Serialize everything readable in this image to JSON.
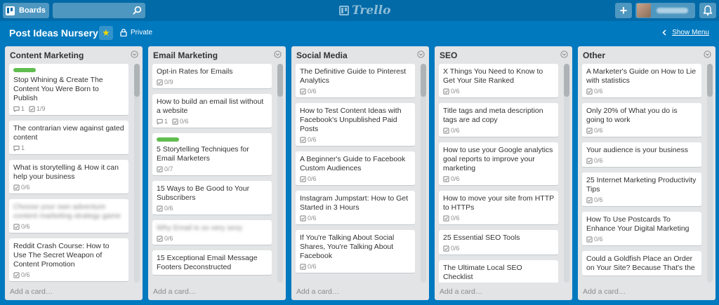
{
  "topbar": {
    "boards_label": "Boards",
    "search_placeholder": "",
    "logo_text": "Trello",
    "add_label": "+"
  },
  "board": {
    "title": "Post Ideas Nursery",
    "star": "★",
    "privacy": "Private",
    "show_menu": "Show Menu"
  },
  "add_card_label": "Add a card…",
  "lists": [
    {
      "title": "Content Marketing",
      "cards": [
        {
          "label": "green",
          "title": "Stop Whining & Create The Content You Were Born to Publish",
          "blurred": false,
          "comments": "1",
          "checklist": "1/9"
        },
        {
          "title": "The contrarian view against gated content",
          "blurred": false,
          "comments": "1"
        },
        {
          "title": "What is storytelling & How it can help your business",
          "blurred": false,
          "checklist": "0/6"
        },
        {
          "title": "Choose your own adventure content marketing strategy game",
          "blurred": true,
          "checklist": "0/6"
        },
        {
          "title": "Reddit Crash Course: How to Use The Secret Weapon of Content Promotion",
          "blurred": false,
          "checklist": "0/6"
        }
      ]
    },
    {
      "title": "Email Marketing",
      "cards": [
        {
          "title": "Opt-in Rates for Emails",
          "blurred": false,
          "checklist": "0/9"
        },
        {
          "title": "How to build an email list without a website",
          "blurred": false,
          "comments": "1",
          "checklist": "0/6"
        },
        {
          "label": "green",
          "title": "5 Storytelling Techniques for Email Marketers",
          "blurred": false,
          "checklist": "0/7"
        },
        {
          "title": "15 Ways to Be Good to Your Subscribers",
          "blurred": false,
          "checklist": "0/6"
        },
        {
          "title": "Why Email is so very sexy",
          "blurred": true,
          "checklist": "0/6"
        },
        {
          "title": "15 Exceptional Email Message Footers Deconstructed",
          "blurred": false
        }
      ]
    },
    {
      "title": "Social Media",
      "cards": [
        {
          "title": "The Definitive Guide to Pinterest Analytics",
          "blurred": false,
          "checklist": "0/6"
        },
        {
          "title": "How to Test Content Ideas with Facebook's Unpublished Paid Posts",
          "blurred": false,
          "checklist": "0/6"
        },
        {
          "title": "A Beginner's Guide to Facebook Custom Audiences",
          "blurred": false,
          "checklist": "0/6"
        },
        {
          "title": "Instagram Jumpstart: How to Get Started in 3 Hours",
          "blurred": false,
          "checklist": "0/6"
        },
        {
          "title": "If You're Talking About Social Shares, You're Talking About Facebook",
          "blurred": false,
          "checklist": "0/6"
        }
      ]
    },
    {
      "title": "SEO",
      "cards": [
        {
          "title": "X Things You Need to Know to Get Your Site Ranked",
          "blurred": false,
          "checklist": "0/6"
        },
        {
          "title": "Title tags and meta description tags are ad copy",
          "blurred": false,
          "checklist": "0/6"
        },
        {
          "title": "How to use your Google analytics goal reports to improve your marketing",
          "blurred": false,
          "checklist": "0/6"
        },
        {
          "title": "How to move your site from HTTP to HTTPs",
          "blurred": false,
          "checklist": "0/6"
        },
        {
          "title": "25 Essential SEO Tools",
          "blurred": false,
          "checklist": "0/6"
        },
        {
          "title": "The Ultimate Local SEO Checklist",
          "blurred": false
        }
      ]
    },
    {
      "title": "Other",
      "cards": [
        {
          "title": "A Marketer's Guide on How to Lie with statistics",
          "blurred": false,
          "checklist": "0/6"
        },
        {
          "title": "Only 20% of What you do is going to work",
          "blurred": false,
          "checklist": "0/6"
        },
        {
          "title": "Your audience is your business",
          "blurred": false,
          "checklist": "0/6"
        },
        {
          "title": "25 Internet Marketing Productivity Tips",
          "blurred": false,
          "checklist": "0/6"
        },
        {
          "title": "How To Use Postcards To Enhance Your Digital Marketing",
          "blurred": false,
          "checklist": "0/6"
        },
        {
          "title": "Could a Goldfish Place an Order on Your Site? Because That's the",
          "blurred": false
        }
      ]
    }
  ],
  "colors": {
    "background": "#0079bf",
    "topbar": "#026aa7",
    "list": "#e2e4e6",
    "label_green": "#61bd4f",
    "star": "#f2d600"
  },
  "icons": [
    "boards-icon",
    "search-icon",
    "trello-logo-icon",
    "plus-icon",
    "bell-icon",
    "star-icon",
    "lock-icon",
    "chevron-left-icon",
    "list-menu-icon",
    "comment-icon",
    "checklist-icon"
  ]
}
